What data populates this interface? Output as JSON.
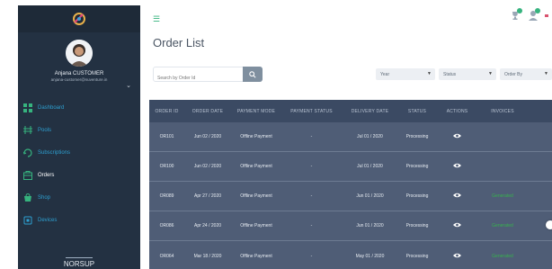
{
  "sidebar": {
    "user_name": "Anjana CUSTOMER",
    "user_email": "anjana-customer@nuventure.in",
    "items": [
      {
        "label": "Dashboard",
        "icon": "dashboard-icon"
      },
      {
        "label": "Pools",
        "icon": "pools-icon"
      },
      {
        "label": "Subscriptions",
        "icon": "subscriptions-icon"
      },
      {
        "label": "Orders",
        "icon": "orders-icon",
        "active": true
      },
      {
        "label": "Shop",
        "icon": "shop-icon"
      },
      {
        "label": "Devices",
        "icon": "devices-icon"
      }
    ],
    "brand": "NORSUP"
  },
  "topbar": {
    "menu_icon": "hamburger-icon",
    "icons": [
      "trophy-icon",
      "user-icon"
    ]
  },
  "main": {
    "title": "Order List",
    "search_placeholder": "Search by Order Id",
    "filters": [
      {
        "label": "Year"
      },
      {
        "label": "Status"
      },
      {
        "label": "Order By"
      }
    ]
  },
  "table": {
    "headers": [
      "ORDER ID",
      "ORDER DATE",
      "PAYMENT MODE",
      "PAYMENT STATUS",
      "DELIVERY DATE",
      "STATUS",
      "ACTIONS",
      "INVOICES"
    ],
    "rows": [
      {
        "id": "OR101",
        "date": "Jun 02 / 2020",
        "mode": "Offline Payment",
        "pay_status": "-",
        "delivery": "Jul 01 / 2020",
        "status": "Processing",
        "invoice": ""
      },
      {
        "id": "OR100",
        "date": "Jun 02 / 2020",
        "mode": "Offline Payment",
        "pay_status": "-",
        "delivery": "Jul 01 / 2020",
        "status": "Processing",
        "invoice": ""
      },
      {
        "id": "OR089",
        "date": "Apr 27 / 2020",
        "mode": "Offline Payment",
        "pay_status": "-",
        "delivery": "Jun 01 / 2020",
        "status": "Processing",
        "invoice": "Generated"
      },
      {
        "id": "OR086",
        "date": "Apr 24 / 2020",
        "mode": "Offline Payment",
        "pay_status": "-",
        "delivery": "Jun 01 / 2020",
        "status": "Processing",
        "invoice": "Generated"
      },
      {
        "id": "OR064",
        "date": "Mar 18 / 2020",
        "mode": "Offline Payment",
        "pay_status": "-",
        "delivery": "May 01 / 2020",
        "status": "Processing",
        "invoice": "Generated"
      }
    ]
  },
  "colors": {
    "sidebar_bg": "#233142",
    "accent_blue": "#2d9fd0",
    "accent_green": "#36b37e",
    "table_bg": "#4f5d76",
    "table_header_bg": "#3b4a63"
  }
}
